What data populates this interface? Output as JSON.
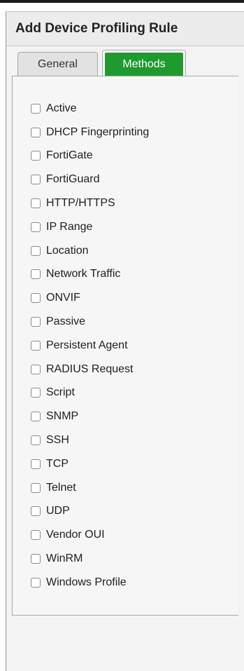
{
  "dialog": {
    "title": "Add Device Profiling Rule"
  },
  "tabs": [
    {
      "label": "General",
      "selected": false
    },
    {
      "label": "Methods",
      "selected": true
    }
  ],
  "colors": {
    "active_tab": "#1f9a2f"
  },
  "methods": [
    {
      "label": "Active",
      "checked": false
    },
    {
      "label": "DHCP Fingerprinting",
      "checked": false
    },
    {
      "label": "FortiGate",
      "checked": false
    },
    {
      "label": "FortiGuard",
      "checked": false
    },
    {
      "label": "HTTP/HTTPS",
      "checked": false
    },
    {
      "label": "IP Range",
      "checked": false
    },
    {
      "label": "Location",
      "checked": false
    },
    {
      "label": "Network Traffic",
      "checked": false
    },
    {
      "label": "ONVIF",
      "checked": false
    },
    {
      "label": "Passive",
      "checked": false
    },
    {
      "label": "Persistent Agent",
      "checked": false
    },
    {
      "label": "RADIUS Request",
      "checked": false
    },
    {
      "label": "Script",
      "checked": false
    },
    {
      "label": "SNMP",
      "checked": false
    },
    {
      "label": "SSH",
      "checked": false
    },
    {
      "label": "TCP",
      "checked": false
    },
    {
      "label": "Telnet",
      "checked": false
    },
    {
      "label": "UDP",
      "checked": false
    },
    {
      "label": "Vendor OUI",
      "checked": false
    },
    {
      "label": "WinRM",
      "checked": false
    },
    {
      "label": "Windows Profile",
      "checked": false
    }
  ]
}
